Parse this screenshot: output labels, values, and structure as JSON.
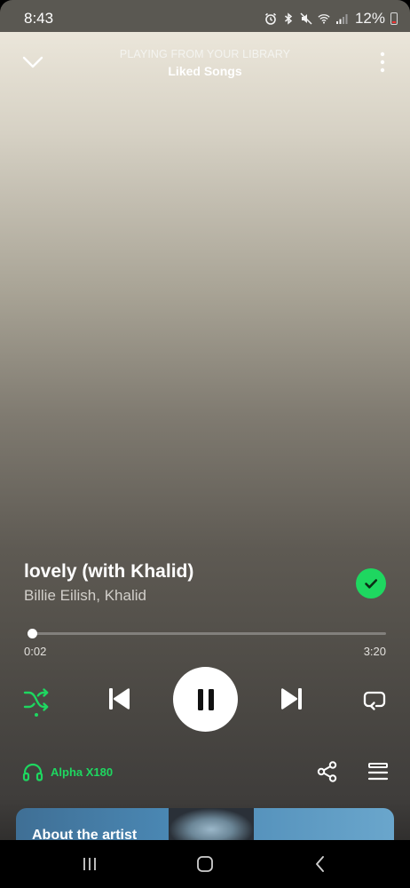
{
  "status_bar": {
    "time": "8:43",
    "battery": "12%",
    "icons": [
      "alarm-icon",
      "bluetooth-icon",
      "mute-icon",
      "wifi-icon",
      "signal-icon",
      "battery-icon"
    ]
  },
  "header": {
    "context_label": "PLAYING FROM YOUR LIBRARY",
    "context_title": "Liked Songs",
    "collapse_icon": "chevron-down-icon",
    "more_icon": "more-vertical-icon"
  },
  "track": {
    "title": "lovely (with Khalid)",
    "artists": "Billie Eilish, Khalid",
    "liked": true
  },
  "progress": {
    "current": "0:02",
    "total": "3:20",
    "fraction": 0.01
  },
  "controls": {
    "shuffle_on": true,
    "state": "playing",
    "icons": [
      "shuffle-icon",
      "skip-previous-icon",
      "pause-icon",
      "skip-next-icon",
      "repeat-icon"
    ]
  },
  "device": {
    "name": "Alpha X180",
    "icon": "headphones-icon"
  },
  "artist_card": {
    "title": "About the artist"
  },
  "colors": {
    "accent": "#1ed760",
    "card": "#4a87b3"
  }
}
